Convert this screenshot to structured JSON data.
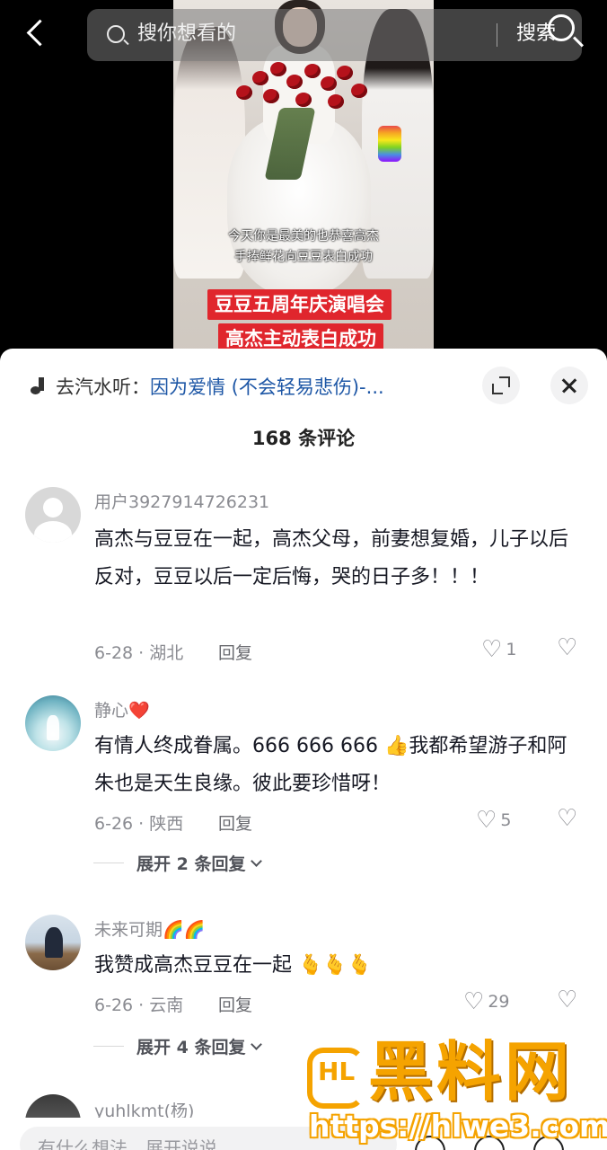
{
  "search": {
    "placeholder": "搜你想看的",
    "button_label": "搜索"
  },
  "video": {
    "caption_line1": "今天你是最美的也恭喜高杰",
    "caption_line2": "手捧鲜花向豆豆表白成功",
    "title_line1": "豆豆五周年庆演唱会",
    "title_line2": "高杰主动表白成功"
  },
  "music": {
    "prefix": "去汽水听：",
    "title": "因为爱情 (不会轻易悲伤)-..."
  },
  "comment_count": "168 条评论",
  "comments": [
    {
      "username": "用户3927914726231",
      "text": "高杰与豆豆在一起，高杰父母，前妻想复婚，儿子以后反对，豆豆以后一定后悔，哭的日子多！！！",
      "meta": "6-28 · 湖北",
      "reply_label": "回复",
      "likes": "1"
    },
    {
      "username": "静心❤️",
      "text": "有情人终成眷属。666 666 666 👍我都希望游子和阿朱也是天生良缘。彼此要珍惜呀！",
      "meta": "6-26 · 陕西",
      "reply_label": "回复",
      "likes": "5",
      "expand_label": "展开 2 条回复"
    },
    {
      "username": "未来可期🌈🌈",
      "text": "我赞成高杰豆豆在一起 🫰🫰🫰",
      "meta": "6-26 · 云南",
      "reply_label": "回复",
      "likes": "29",
      "expand_label": "展开 4 条回复"
    },
    {
      "username": "yuhlkmt(杨)"
    }
  ],
  "input": {
    "placeholder": "有什么想法，展开说说"
  },
  "watermark": {
    "title": "黑料网",
    "url": "https://hlwe3.com"
  },
  "icons": {
    "back": "chevron-left-icon",
    "search": "search-icon",
    "music": "music-note-icon",
    "expand": "expand-icon",
    "close": "close-icon",
    "like": "heart-icon",
    "dislike": "broken-heart-icon"
  }
}
